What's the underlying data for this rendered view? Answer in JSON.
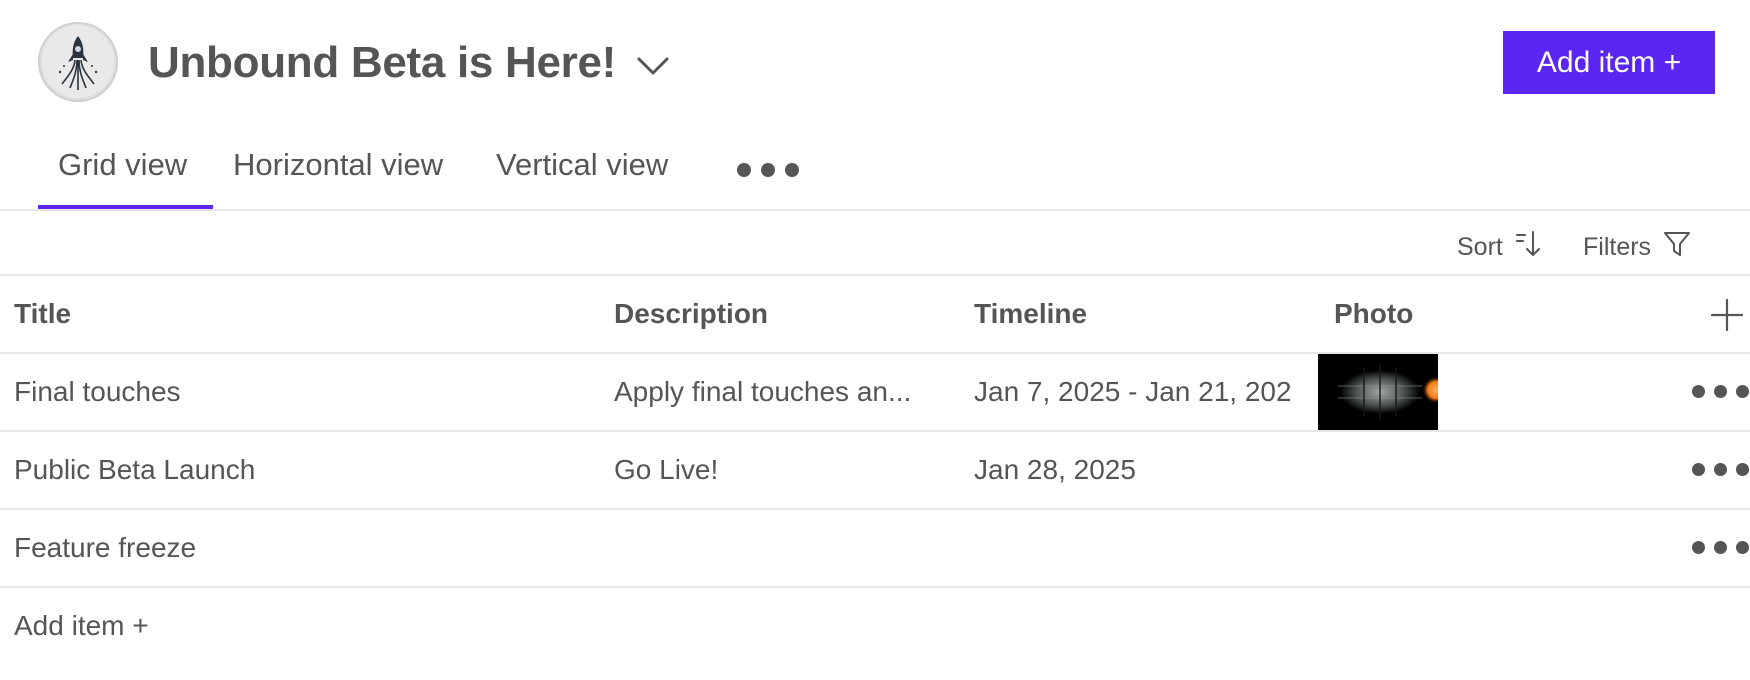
{
  "header": {
    "title": "Unbound Beta is Here!",
    "add_button_label": "Add item +",
    "accent_color": "#5b25f2"
  },
  "tabs": [
    {
      "label": "Grid view",
      "active": true
    },
    {
      "label": "Horizontal view",
      "active": false
    },
    {
      "label": "Vertical view",
      "active": false
    }
  ],
  "toolbar": {
    "sort_label": "Sort",
    "filters_label": "Filters"
  },
  "table": {
    "columns": [
      "Title",
      "Description",
      "Timeline",
      "Photo"
    ],
    "rows": [
      {
        "title": "Final touches",
        "description": "Apply final touches an...",
        "timeline": "Jan 7, 2025 - Jan 21, 202",
        "has_photo": true
      },
      {
        "title": "Public Beta Launch",
        "description": "Go Live!",
        "timeline": "Jan 28, 2025",
        "has_photo": false
      },
      {
        "title": "Feature freeze",
        "description": "",
        "timeline": "",
        "has_photo": false
      }
    ],
    "add_row_label": "Add item +"
  },
  "icons": {
    "logo": "rocket-logo-icon",
    "title_dropdown": "chevron-down-icon",
    "tabs_more": "more-horizontal-icon",
    "sort": "sort-icon",
    "filters": "filter-icon",
    "add_column": "plus-icon",
    "row_more": "more-horizontal-icon"
  }
}
